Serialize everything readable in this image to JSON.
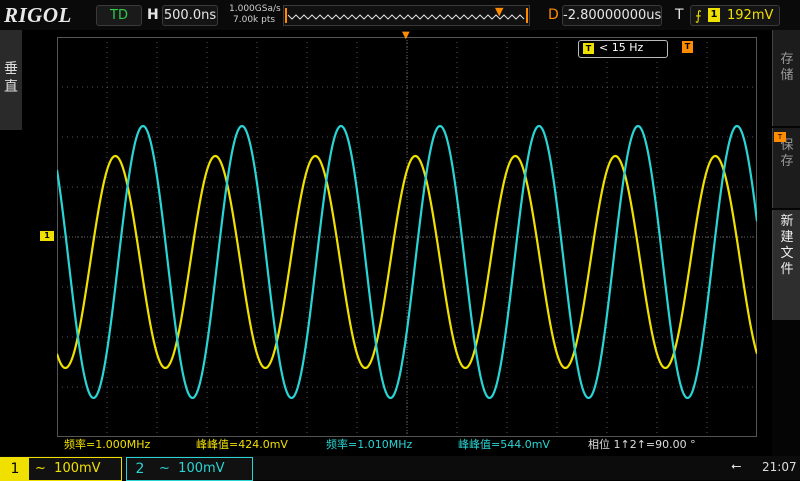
{
  "brand": "RIGOL",
  "run_status": "TD",
  "horizontal": {
    "label": "H",
    "timebase": "500.0ns",
    "sample_rate": "1.000GSa/s",
    "memory_depth": "7.00k pts"
  },
  "delay": {
    "label": "D",
    "value": "-2.80000000us"
  },
  "trigger": {
    "label": "T",
    "source": "1",
    "edge": "rising",
    "level": "192mV"
  },
  "trigger_filter": {
    "source": "T",
    "text": "< 15 Hz"
  },
  "left_menu": {
    "label": "垂直"
  },
  "right_menu": {
    "items": [
      "存储",
      "保存",
      "新建文件"
    ]
  },
  "measurements": [
    {
      "label": "频率=1.000MHz",
      "channel": 1
    },
    {
      "label": "峰峰值=424.0mV",
      "channel": 1
    },
    {
      "label": "频率=1.010MHz",
      "channel": 2
    },
    {
      "label": "峰峰值=544.0mV",
      "channel": 2
    },
    {
      "label": "相位 1↑2↑=90.00 °",
      "channel": 0
    }
  ],
  "channels": [
    {
      "number": "1",
      "coupling": "~",
      "scale": "100mV",
      "color": "#f0e000"
    },
    {
      "number": "2",
      "coupling": "~",
      "scale": "100mV",
      "color": "#2ad4d4"
    }
  ],
  "clock": "21:07",
  "ch1_marker": "1",
  "colors": {
    "ch1": "#f0e000",
    "ch2": "#2ad4d4",
    "accent": "#ff8c00"
  },
  "chart_data": {
    "type": "line",
    "series": [
      {
        "channel": "1",
        "frequency_mhz": 1.0,
        "vpp_mv": 424.0,
        "color": "#f0e000"
      },
      {
        "channel": "2",
        "frequency_mhz": 1.01,
        "vpp_mv": 544.0,
        "color": "#2ad4d4"
      }
    ],
    "phase_deg": 90.0,
    "grid": true
  }
}
